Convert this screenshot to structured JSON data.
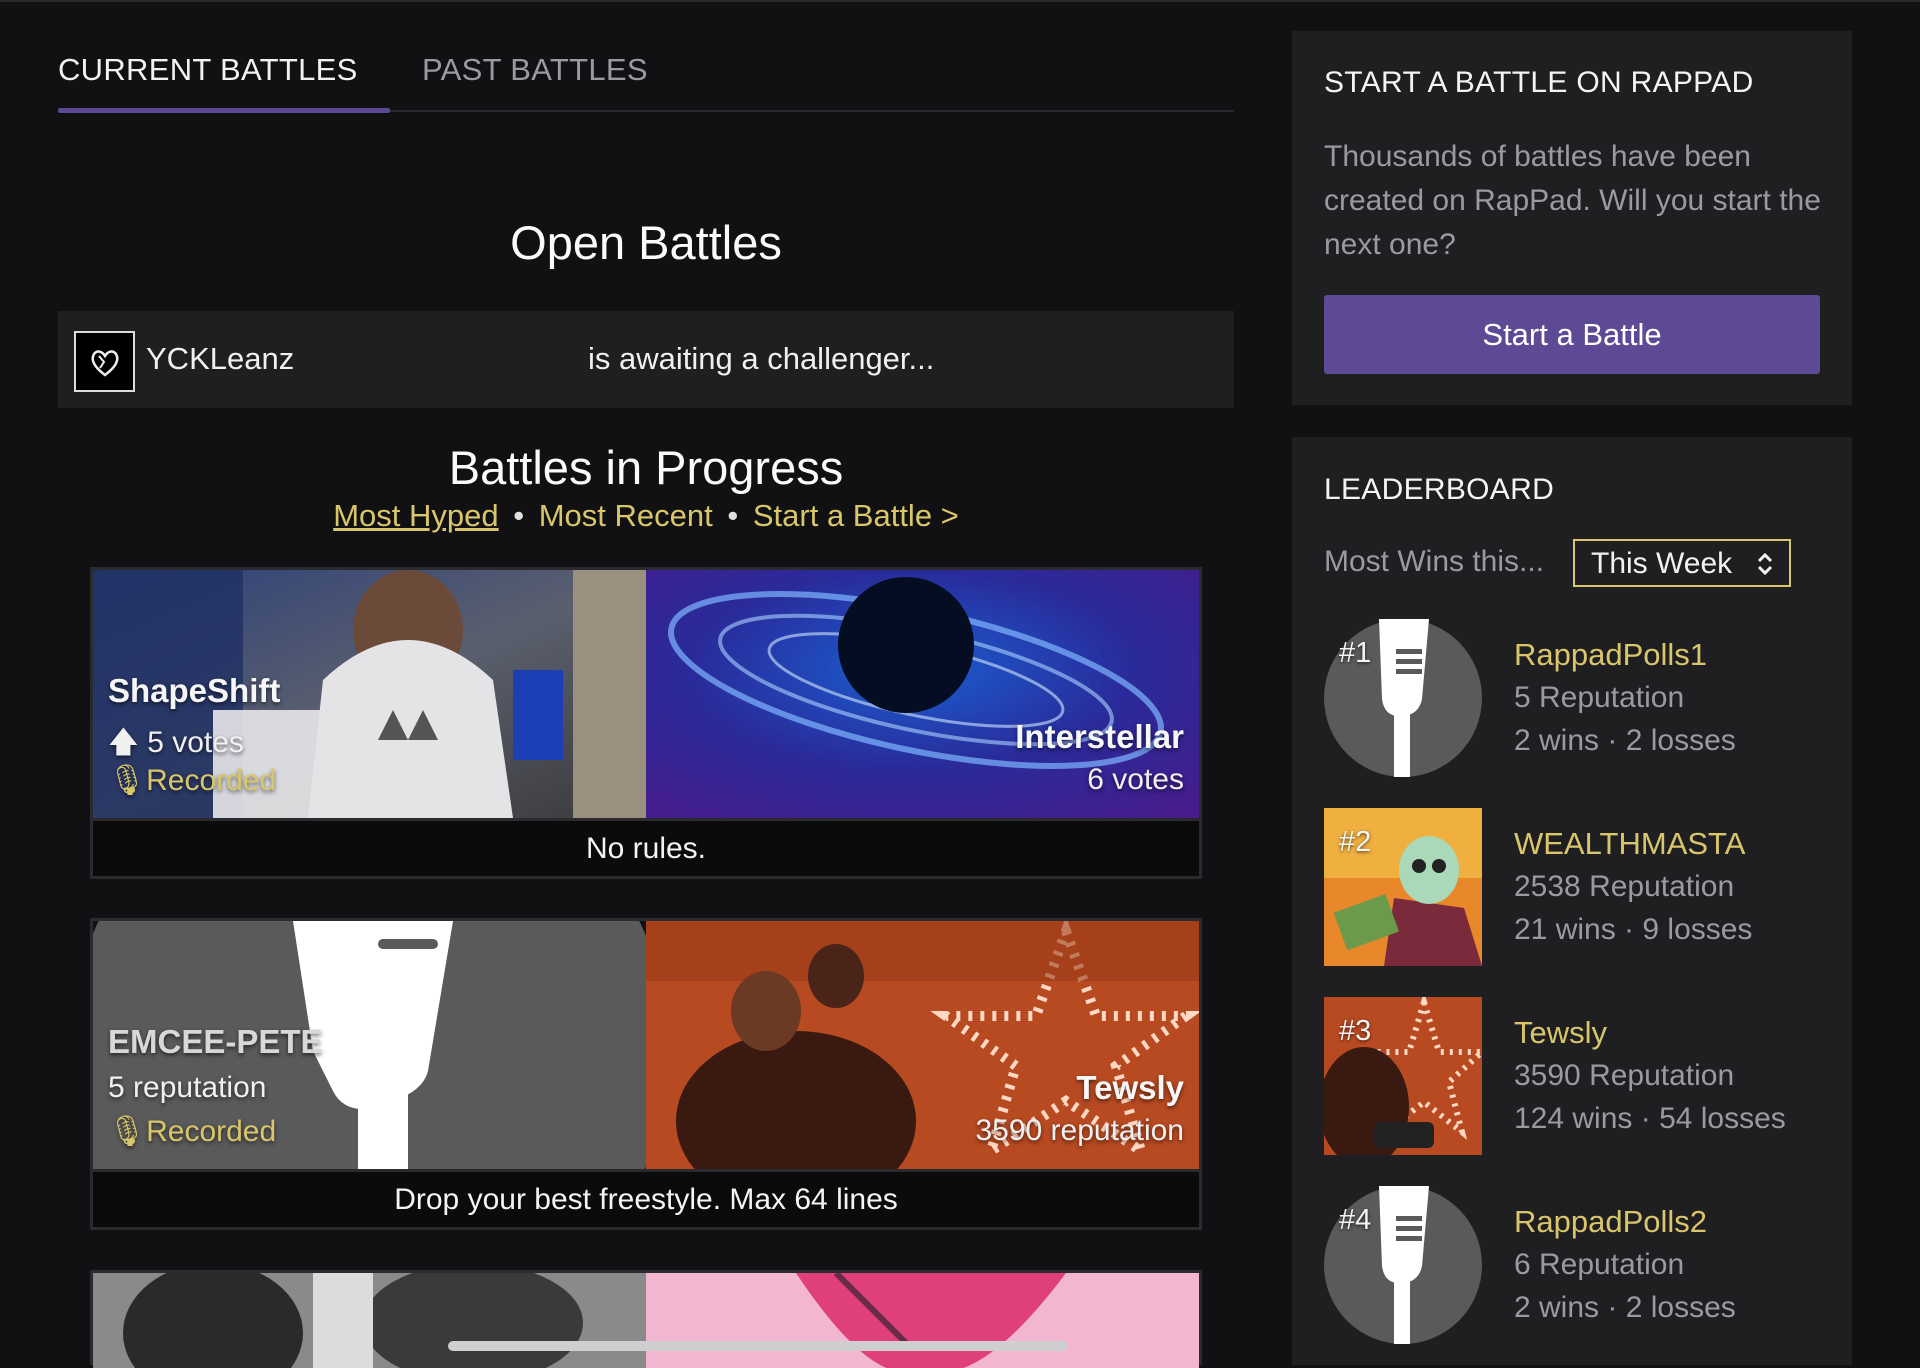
{
  "tabs": {
    "current": "CURRENT BATTLES",
    "past": "PAST BATTLES"
  },
  "open_battles": {
    "title": "Open Battles",
    "entries": [
      {
        "name": "YCKLeanz",
        "status": "is awaiting a challenger..."
      }
    ]
  },
  "in_progress": {
    "title": "Battles in Progress",
    "filters": {
      "hyped": "Most Hyped",
      "separator": "•",
      "recent": "Most Recent",
      "start": "Start a Battle >"
    },
    "battles": [
      {
        "left": {
          "name": "ShapeShift",
          "votes": "5 votes",
          "status": "Recorded"
        },
        "right": {
          "name": "Interstellar",
          "votes": "6 votes"
        },
        "rules": "No rules."
      },
      {
        "left": {
          "name": "EMCEE-PETE",
          "reputation": "5 reputation",
          "status": "Recorded"
        },
        "right": {
          "name": "Tewsly",
          "reputation": "3590 reputation"
        },
        "rules": "Drop your best freestyle. Max 64 lines"
      }
    ]
  },
  "start_panel": {
    "title": "START A BATTLE ON RAPPAD",
    "text": "Thousands of battles have been created on RapPad. Will you start the next one?",
    "button": "Start a Battle"
  },
  "leaderboard": {
    "title": "LEADERBOARD",
    "label": "Most Wins this...",
    "period": "This Week",
    "entries": [
      {
        "rank": "#1",
        "name": "RappadPolls1",
        "reputation": "5 Reputation",
        "record": "2 wins · 2 losses"
      },
      {
        "rank": "#2",
        "name": "WEALTHMASTA",
        "reputation": "2538 Reputation",
        "record": "21 wins · 9 losses"
      },
      {
        "rank": "#3",
        "name": "Tewsly",
        "reputation": "3590 Reputation",
        "record": "124 wins · 54 losses"
      },
      {
        "rank": "#4",
        "name": "RappadPolls2",
        "reputation": "6 Reputation",
        "record": "2 wins · 2 losses"
      }
    ]
  },
  "colors": {
    "accent": "#5e4a94",
    "gold": "#d9c66b",
    "panel": "#1f1f22",
    "background": "#111113"
  }
}
